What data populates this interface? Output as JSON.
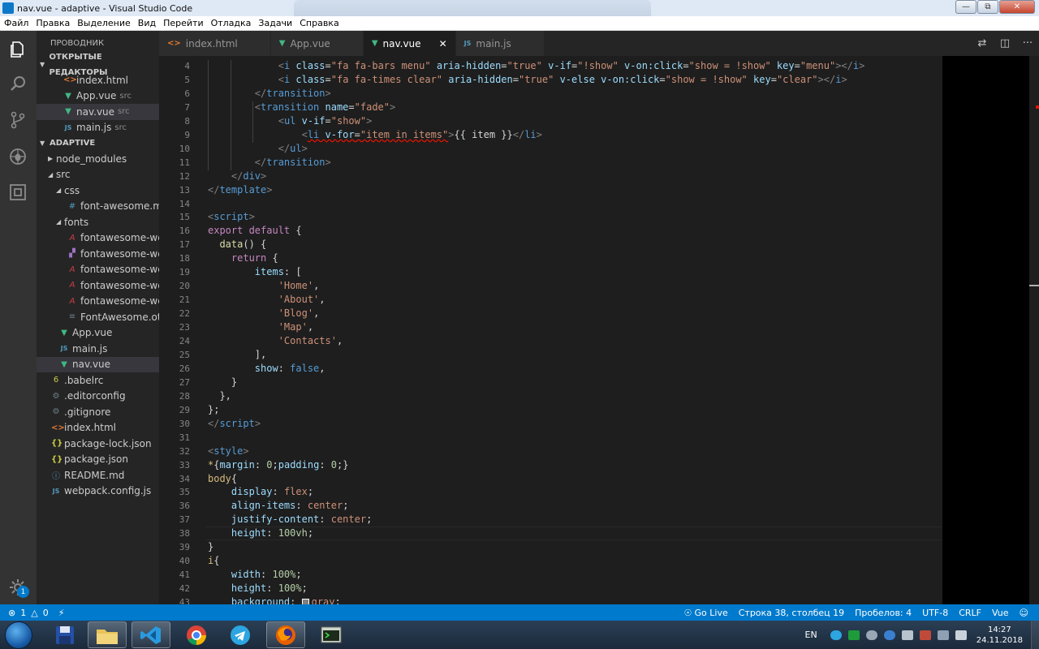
{
  "window": {
    "title": "nav.vue - adaptive - Visual Studio Code"
  },
  "menu": [
    "Файл",
    "Правка",
    "Выделение",
    "Вид",
    "Перейти",
    "Отладка",
    "Задачи",
    "Справка"
  ],
  "sidebar": {
    "title": "ПРОВОДНИК",
    "open_editors_title": "ОТКРЫТЫЕ РЕДАКТОРЫ",
    "open_editors": [
      {
        "name": "index.html",
        "desc": "",
        "icon": "html-icon"
      },
      {
        "name": "App.vue",
        "desc": "src",
        "icon": "vue-icon"
      },
      {
        "name": "nav.vue",
        "desc": "src",
        "icon": "vue-icon"
      },
      {
        "name": "main.js",
        "desc": "src",
        "icon": "js-icon"
      }
    ],
    "project_title": "ADAPTIVE",
    "tree": [
      {
        "name": "node_modules",
        "kind": "folder-collapsed",
        "depth": 0
      },
      {
        "name": "src",
        "kind": "folder-open",
        "depth": 0
      },
      {
        "name": "css",
        "kind": "folder-open",
        "depth": 1
      },
      {
        "name": "font-awesome.mi...",
        "kind": "css",
        "depth": 2
      },
      {
        "name": "fonts",
        "kind": "folder-open",
        "depth": 1
      },
      {
        "name": "fontawesome-we...",
        "kind": "font",
        "depth": 2
      },
      {
        "name": "fontawesome-we...",
        "kind": "font2",
        "depth": 2
      },
      {
        "name": "fontawesome-we...",
        "kind": "font",
        "depth": 2
      },
      {
        "name": "fontawesome-we...",
        "kind": "font",
        "depth": 2
      },
      {
        "name": "fontawesome-we...",
        "kind": "font",
        "depth": 2
      },
      {
        "name": "FontAwesome.otf",
        "kind": "file",
        "depth": 2
      },
      {
        "name": "App.vue",
        "kind": "vue",
        "depth": 1
      },
      {
        "name": "main.js",
        "kind": "js",
        "depth": 1
      },
      {
        "name": "nav.vue",
        "kind": "vue",
        "depth": 1
      },
      {
        "name": ".babelrc",
        "kind": "babel",
        "depth": 0
      },
      {
        "name": ".editorconfig",
        "kind": "gear",
        "depth": 0
      },
      {
        "name": ".gitignore",
        "kind": "gear",
        "depth": 0
      },
      {
        "name": "index.html",
        "kind": "html",
        "depth": 0
      },
      {
        "name": "package-lock.json",
        "kind": "json",
        "depth": 0
      },
      {
        "name": "package.json",
        "kind": "json",
        "depth": 0
      },
      {
        "name": "README.md",
        "kind": "info",
        "depth": 0
      },
      {
        "name": "webpack.config.js",
        "kind": "js",
        "depth": 0
      }
    ]
  },
  "tabs": [
    {
      "label": "index.html",
      "icon": "html-icon",
      "active": false
    },
    {
      "label": "App.vue",
      "icon": "vue-icon",
      "active": false
    },
    {
      "label": "nav.vue",
      "icon": "vue-icon",
      "active": true
    },
    {
      "label": "main.js",
      "icon": "js-icon",
      "active": false
    }
  ],
  "editor": {
    "current_line": 38,
    "lines": [
      {
        "n": 4,
        "indent": 3,
        "tokens": [
          [
            "<",
            "pun2"
          ],
          [
            "i",
            "tag"
          ],
          [
            " class",
            "attr"
          ],
          [
            "=",
            "pun"
          ],
          [
            "\"fa fa-bars menu\"",
            "str"
          ],
          [
            " aria-hidden",
            "attr"
          ],
          [
            "=",
            "pun"
          ],
          [
            "\"true\"",
            "str"
          ],
          [
            " v-if",
            "attr"
          ],
          [
            "=",
            "pun"
          ],
          [
            "\"!show\"",
            "str"
          ],
          [
            " v-on:click",
            "attr"
          ],
          [
            "=",
            "pun"
          ],
          [
            "\"show = !show\"",
            "str"
          ],
          [
            " key",
            "attr"
          ],
          [
            "=",
            "pun"
          ],
          [
            "\"menu\"",
            "str"
          ],
          [
            "></",
            "pun2"
          ],
          [
            "i",
            "tag"
          ],
          [
            ">",
            "pun2"
          ]
        ]
      },
      {
        "n": 5,
        "indent": 3,
        "tokens": [
          [
            "<",
            "pun2"
          ],
          [
            "i",
            "tag"
          ],
          [
            " class",
            "attr"
          ],
          [
            "=",
            "pun"
          ],
          [
            "\"fa fa-times clear\"",
            "str"
          ],
          [
            " aria-hidden",
            "attr"
          ],
          [
            "=",
            "pun"
          ],
          [
            "\"true\"",
            "str"
          ],
          [
            " v-else",
            "attr"
          ],
          [
            " v-on:click",
            "attr"
          ],
          [
            "=",
            "pun"
          ],
          [
            "\"show = !show\"",
            "str"
          ],
          [
            " key",
            "attr"
          ],
          [
            "=",
            "pun"
          ],
          [
            "\"clear\"",
            "str"
          ],
          [
            "></",
            "pun2"
          ],
          [
            "i",
            "tag"
          ],
          [
            ">",
            "pun2"
          ]
        ]
      },
      {
        "n": 6,
        "indent": 2,
        "tokens": [
          [
            "</",
            "pun2"
          ],
          [
            "transition",
            "tag"
          ],
          [
            ">",
            "pun2"
          ]
        ]
      },
      {
        "n": 7,
        "indent": 2,
        "tokens": [
          [
            "<",
            "pun2"
          ],
          [
            "transition",
            "tag"
          ],
          [
            " name",
            "attr"
          ],
          [
            "=",
            "pun"
          ],
          [
            "\"fade\"",
            "str"
          ],
          [
            ">",
            "pun2"
          ]
        ]
      },
      {
        "n": 8,
        "indent": 3,
        "tokens": [
          [
            "<",
            "pun2"
          ],
          [
            "ul",
            "tag"
          ],
          [
            " v-if",
            "attr"
          ],
          [
            "=",
            "pun"
          ],
          [
            "\"show\"",
            "str"
          ],
          [
            ">",
            "pun2"
          ]
        ]
      },
      {
        "n": 9,
        "indent": 4,
        "tokens": [
          [
            "<",
            "pun2"
          ],
          [
            "li",
            "tag squig"
          ],
          [
            " v-for",
            "attr squig"
          ],
          [
            "=",
            "pun squig"
          ],
          [
            "\"item in items\"",
            "str squig"
          ],
          [
            ">",
            "pun2"
          ],
          [
            "{{ item }}",
            "pun"
          ],
          [
            "</",
            "pun2"
          ],
          [
            "li",
            "tag"
          ],
          [
            ">",
            "pun2"
          ]
        ]
      },
      {
        "n": 10,
        "indent": 3,
        "tokens": [
          [
            "</",
            "pun2"
          ],
          [
            "ul",
            "tag"
          ],
          [
            ">",
            "pun2"
          ]
        ]
      },
      {
        "n": 11,
        "indent": 2,
        "tokens": [
          [
            "</",
            "pun2"
          ],
          [
            "transition",
            "tag"
          ],
          [
            ">",
            "pun2"
          ]
        ]
      },
      {
        "n": 12,
        "indent": 1,
        "tokens": [
          [
            "</",
            "pun2"
          ],
          [
            "div",
            "tag"
          ],
          [
            ">",
            "pun2"
          ]
        ]
      },
      {
        "n": 13,
        "indent": 0,
        "tokens": [
          [
            "</",
            "pun2"
          ],
          [
            "template",
            "tag"
          ],
          [
            ">",
            "pun2"
          ]
        ]
      },
      {
        "n": 14,
        "indent": 0,
        "tokens": []
      },
      {
        "n": 15,
        "indent": 0,
        "tokens": [
          [
            "<",
            "pun2"
          ],
          [
            "script",
            "tag"
          ],
          [
            ">",
            "pun2"
          ]
        ]
      },
      {
        "n": 16,
        "indent": 0,
        "tokens": [
          [
            "export",
            "kw2"
          ],
          [
            " default",
            "kw2"
          ],
          [
            " {",
            "pun"
          ]
        ]
      },
      {
        "n": 17,
        "indent": 0,
        "pre": "  ",
        "tokens": [
          [
            "data",
            "fn"
          ],
          [
            "() {",
            "pun"
          ]
        ]
      },
      {
        "n": 18,
        "indent": 0,
        "pre": "    ",
        "tokens": [
          [
            "return",
            "kw2"
          ],
          [
            " {",
            "pun"
          ]
        ]
      },
      {
        "n": 19,
        "indent": 0,
        "pre": "        ",
        "tokens": [
          [
            "items",
            "prop"
          ],
          [
            ": [",
            "pun"
          ]
        ]
      },
      {
        "n": 20,
        "indent": 0,
        "pre": "            ",
        "tokens": [
          [
            "'Home'",
            "str"
          ],
          [
            ",",
            "pun"
          ]
        ]
      },
      {
        "n": 21,
        "indent": 0,
        "pre": "            ",
        "tokens": [
          [
            "'About'",
            "str"
          ],
          [
            ",",
            "pun"
          ]
        ]
      },
      {
        "n": 22,
        "indent": 0,
        "pre": "            ",
        "tokens": [
          [
            "'Blog'",
            "str"
          ],
          [
            ",",
            "pun"
          ]
        ]
      },
      {
        "n": 23,
        "indent": 0,
        "pre": "            ",
        "tokens": [
          [
            "'Map'",
            "str"
          ],
          [
            ",",
            "pun"
          ]
        ]
      },
      {
        "n": 24,
        "indent": 0,
        "pre": "            ",
        "tokens": [
          [
            "'Contacts'",
            "str"
          ],
          [
            ",",
            "pun"
          ]
        ]
      },
      {
        "n": 25,
        "indent": 0,
        "pre": "        ",
        "tokens": [
          [
            "],",
            "pun"
          ]
        ]
      },
      {
        "n": 26,
        "indent": 0,
        "pre": "        ",
        "tokens": [
          [
            "show",
            "prop"
          ],
          [
            ": ",
            "pun"
          ],
          [
            "false",
            "kw"
          ],
          [
            ",",
            "pun"
          ]
        ]
      },
      {
        "n": 27,
        "indent": 0,
        "pre": "    ",
        "tokens": [
          [
            "}",
            "pun"
          ]
        ]
      },
      {
        "n": 28,
        "indent": 0,
        "pre": "  ",
        "tokens": [
          [
            "},",
            "pun"
          ]
        ]
      },
      {
        "n": 29,
        "indent": 0,
        "tokens": [
          [
            "};",
            "pun"
          ]
        ]
      },
      {
        "n": 30,
        "indent": 0,
        "tokens": [
          [
            "</",
            "pun2"
          ],
          [
            "script",
            "tag"
          ],
          [
            ">",
            "pun2"
          ]
        ]
      },
      {
        "n": 31,
        "indent": 0,
        "tokens": []
      },
      {
        "n": 32,
        "indent": 0,
        "tokens": [
          [
            "<",
            "pun2"
          ],
          [
            "style",
            "tag"
          ],
          [
            ">",
            "pun2"
          ]
        ]
      },
      {
        "n": 33,
        "indent": 0,
        "tokens": [
          [
            "*",
            "sel"
          ],
          [
            "{",
            "pun"
          ],
          [
            "margin",
            "prop"
          ],
          [
            ": ",
            "pun"
          ],
          [
            "0",
            "num"
          ],
          [
            ";",
            "pun"
          ],
          [
            "padding",
            "prop"
          ],
          [
            ": ",
            "pun"
          ],
          [
            "0",
            "num"
          ],
          [
            ";}",
            "pun"
          ]
        ]
      },
      {
        "n": 34,
        "indent": 0,
        "tokens": [
          [
            "body",
            "sel"
          ],
          [
            "{",
            "pun"
          ]
        ]
      },
      {
        "n": 35,
        "indent": 1,
        "tokens": [
          [
            "display",
            "prop"
          ],
          [
            ": ",
            "pun"
          ],
          [
            "flex",
            "val"
          ],
          [
            ";",
            "pun"
          ]
        ]
      },
      {
        "n": 36,
        "indent": 1,
        "tokens": [
          [
            "align-items",
            "prop"
          ],
          [
            ": ",
            "pun"
          ],
          [
            "center",
            "val"
          ],
          [
            ";",
            "pun"
          ]
        ]
      },
      {
        "n": 37,
        "indent": 1,
        "tokens": [
          [
            "justify-content",
            "prop"
          ],
          [
            ": ",
            "pun"
          ],
          [
            "center",
            "val"
          ],
          [
            ";",
            "pun"
          ]
        ]
      },
      {
        "n": 38,
        "indent": 1,
        "tokens": [
          [
            "height",
            "prop"
          ],
          [
            ": ",
            "pun"
          ],
          [
            "100vh",
            "num"
          ],
          [
            ";",
            "pun"
          ]
        ]
      },
      {
        "n": 39,
        "indent": 0,
        "tokens": [
          [
            "}",
            "pun"
          ]
        ]
      },
      {
        "n": 40,
        "indent": 0,
        "tokens": [
          [
            "i",
            "sel"
          ],
          [
            "{",
            "pun"
          ]
        ]
      },
      {
        "n": 41,
        "indent": 1,
        "tokens": [
          [
            "width",
            "prop"
          ],
          [
            ": ",
            "pun"
          ],
          [
            "100%",
            "num"
          ],
          [
            ";",
            "pun"
          ]
        ]
      },
      {
        "n": 42,
        "indent": 1,
        "tokens": [
          [
            "height",
            "prop"
          ],
          [
            ": ",
            "pun"
          ],
          [
            "100%",
            "num"
          ],
          [
            ";",
            "pun"
          ]
        ]
      },
      {
        "n": 43,
        "indent": 1,
        "tokens": [
          [
            "background",
            "prop"
          ],
          [
            ": ",
            "pun"
          ],
          [
            "#swatch",
            "swatch"
          ],
          [
            "gray",
            "val"
          ],
          [
            ";",
            "pun"
          ]
        ]
      }
    ]
  },
  "statusbar": {
    "errors": "1",
    "warnings": "0",
    "golive": "Go Live",
    "position": "Строка 38, столбец 19",
    "spaces": "Пробелов: 4",
    "encoding": "UTF-8",
    "eol": "CRLF",
    "language": "Vue"
  },
  "activity_badge": "1",
  "taskbar": {
    "lang": "EN",
    "time": "14:27",
    "date": "24.11.2018"
  },
  "colors": {
    "accent": "#007acc",
    "editor_bg": "#1e1e1e",
    "sidebar_bg": "#252526",
    "activity_bg": "#333333"
  }
}
